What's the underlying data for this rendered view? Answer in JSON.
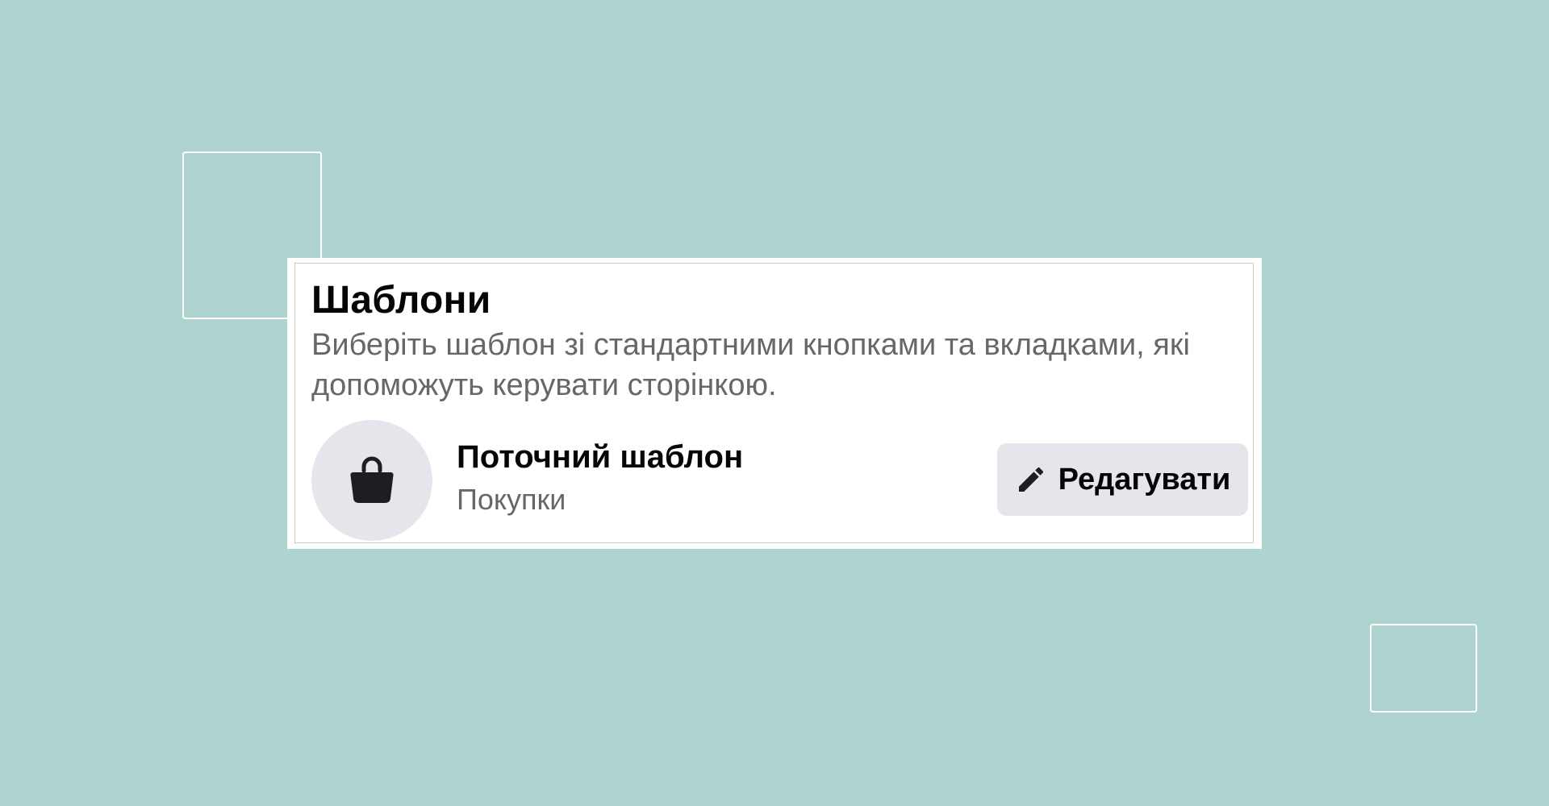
{
  "templates_card": {
    "title": "Шаблони",
    "description": "Виберіть шаблон зі стандартними кнопками та вкладками, які допоможуть керувати сторінкою.",
    "current_template": {
      "label": "Поточний шаблон",
      "value": "Покупки",
      "icon": "shopping-bag-icon"
    },
    "edit_button": {
      "label": "Редагувати",
      "icon": "pencil-icon"
    }
  },
  "colors": {
    "background": "#aed4cf",
    "card": "#ffffff",
    "button": "#e4e6eb",
    "secondary_text": "#65676b",
    "primary_text": "#050505"
  }
}
